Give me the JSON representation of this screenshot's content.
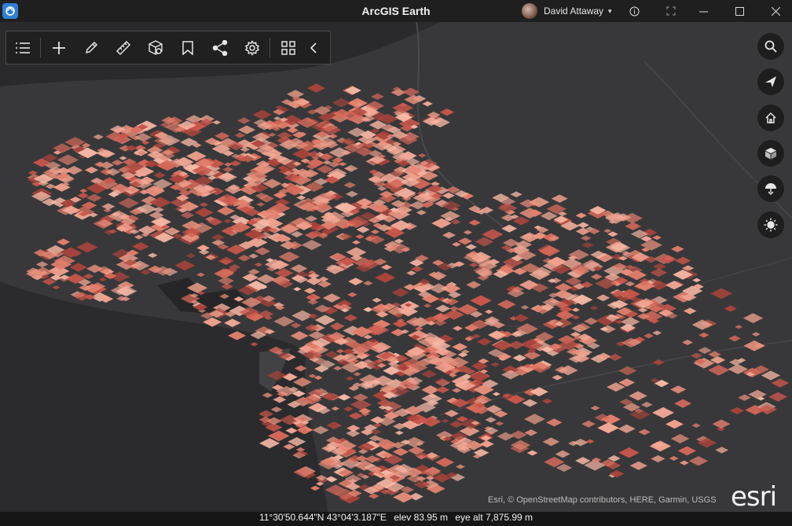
{
  "app": {
    "title": "ArcGIS Earth"
  },
  "user": {
    "name": "David Attaway"
  },
  "window_controls": [
    "info",
    "fullscreen",
    "minimize",
    "maximize",
    "close"
  ],
  "toolbar": {
    "tools": [
      "layers-icon",
      "add-icon",
      "draw-icon",
      "measure-icon",
      "analysis-icon",
      "bookmark-icon",
      "share-icon",
      "settings-icon",
      "apps-icon",
      "collapse-icon"
    ]
  },
  "nav": {
    "buttons": [
      "search-icon",
      "navigate-icon",
      "home-icon",
      "basemap-icon",
      "elevation-icon",
      "daylight-icon"
    ]
  },
  "attribution": "Esri, © OpenStreetMap contributors, HERE, Garmin, USGS",
  "logo": "esri",
  "status": {
    "latlon": "11°30'50.644\"N 43°04'3.187\"E",
    "elev": "elev 83.95 m",
    "eye_alt": "eye alt 7,875.99 m"
  },
  "colors": {
    "titlebar": "#1f1f20",
    "land": "#3a3a3c",
    "water": "#262628",
    "building_light": "#f0a593",
    "building_dark": "#b0433a"
  }
}
